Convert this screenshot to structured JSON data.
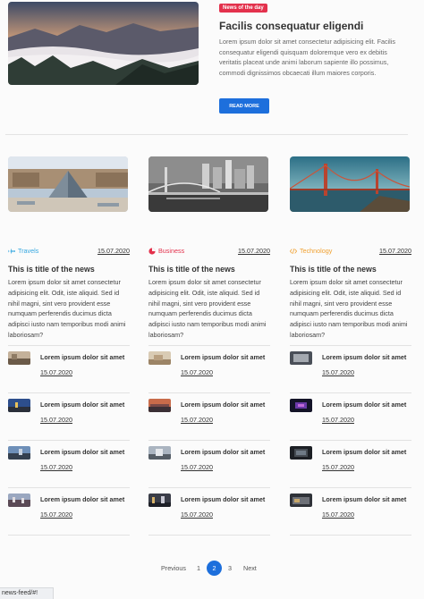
{
  "hero": {
    "badge": "News of the day",
    "title": "Facilis consequatur eligendi",
    "text": "Lorem ipsum dolor sit amet consectetur adipisicing elit. Facilis consequatur eligendi quisquam doloremque vero ex debitis veritatis placeat unde animi laborum sapiente illo possimus, commodi dignissimos obcaecati illum maiores corporis.",
    "button": "READ MORE"
  },
  "columns": [
    {
      "category": "Travels",
      "category_color": "#35a7e0",
      "icon": "plane-icon",
      "date": "15.07.2020",
      "title": "This is title of the news",
      "text": "Lorem ipsum dolor sit amet consectetur adipisicing elit. Odit, iste aliquid. Sed id nihil magni, sint vero provident esse numquam perferendis ducimus dicta adipisci iusto nam temporibus modi animi laboriosam?",
      "items": [
        {
          "title": "Lorem ipsum dolor sit amet",
          "date": "15.07.2020"
        },
        {
          "title": "Lorem ipsum dolor sit amet",
          "date": "15.07.2020"
        },
        {
          "title": "Lorem ipsum dolor sit amet",
          "date": "15.07.2020"
        },
        {
          "title": "Lorem ipsum dolor sit amet",
          "date": "15.07.2020"
        }
      ]
    },
    {
      "category": "Business",
      "category_color": "#e3314c",
      "icon": "pie-chart-icon",
      "date": "15.07.2020",
      "title": "This is title of the news",
      "text": "Lorem ipsum dolor sit amet consectetur adipisicing elit. Odit, iste aliquid. Sed id nihil magni, sint vero provident esse numquam perferendis ducimus dicta adipisci iusto nam temporibus modi animi laboriosam?",
      "items": [
        {
          "title": "Lorem ipsum dolor sit amet",
          "date": "15.07.2020"
        },
        {
          "title": "Lorem ipsum dolor sit amet",
          "date": "15.07.2020"
        },
        {
          "title": "Lorem ipsum dolor sit amet",
          "date": "15.07.2020"
        },
        {
          "title": "Lorem ipsum dolor sit amet",
          "date": "15.07.2020"
        }
      ]
    },
    {
      "category": "Technology",
      "category_color": "#f0a030",
      "icon": "code-icon",
      "date": "15.07.2020",
      "title": "This is title of the news",
      "text": "Lorem ipsum dolor sit amet consectetur adipisicing elit. Odit, iste aliquid. Sed id nihil magni, sint vero provident esse numquam perferendis ducimus dicta adipisci iusto nam temporibus modi animi laboriosam?",
      "items": [
        {
          "title": "Lorem ipsum dolor sit amet",
          "date": "15.07.2020"
        },
        {
          "title": "Lorem ipsum dolor sit amet",
          "date": "15.07.2020"
        },
        {
          "title": "Lorem ipsum dolor sit amet",
          "date": "15.07.2020"
        },
        {
          "title": "Lorem ipsum dolor sit amet",
          "date": "15.07.2020"
        }
      ]
    }
  ],
  "pagination": {
    "previous": "Previous",
    "pages": [
      "1",
      "2",
      "3"
    ],
    "active": "2",
    "next": "Next"
  },
  "status_bar": {
    "url": "news-feed/#!"
  },
  "colors": {
    "accent": "#1d6fdc",
    "badge": "#e3314c"
  }
}
